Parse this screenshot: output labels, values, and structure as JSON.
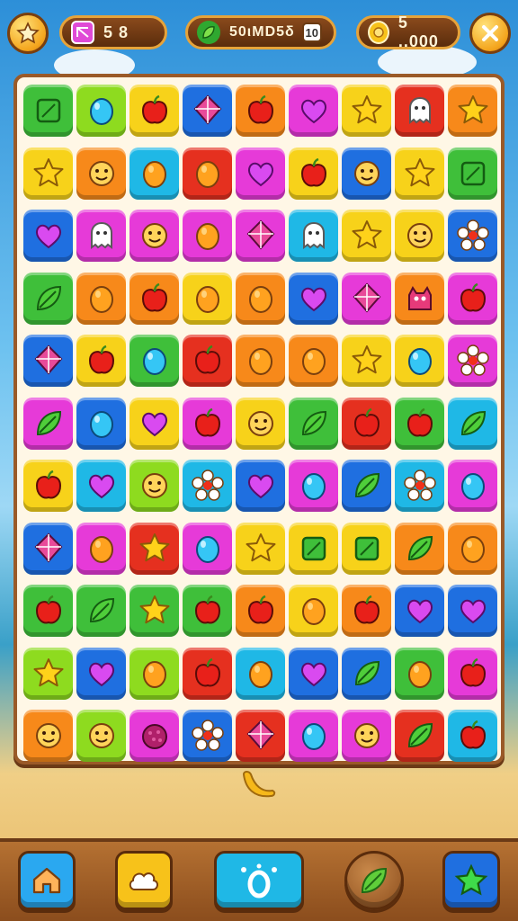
{
  "header": {
    "left_icon": "star-icon",
    "lives": {
      "icon": "ticket-icon",
      "value": "5 8"
    },
    "moves": {
      "icon": "leaf-icon",
      "value": "50ιMD5δ",
      "badge": "10"
    },
    "coins": {
      "icon": "coin-icon",
      "value": "5 ..000"
    },
    "close_icon": "close-icon"
  },
  "board": {
    "rows": [
      [
        [
          "green",
          "square"
        ],
        [
          "lime",
          "drop"
        ],
        [
          "yellow",
          "apple"
        ],
        [
          "blue",
          "kite"
        ],
        [
          "orange",
          "apple"
        ],
        [
          "magenta",
          "heart"
        ],
        [
          "yellow",
          "star"
        ],
        [
          "red",
          "ghost"
        ],
        [
          "orange",
          "star"
        ]
      ],
      [
        [
          "yellow",
          "star"
        ],
        [
          "orange",
          "face"
        ],
        [
          "cyan",
          "orange"
        ],
        [
          "red",
          "orange"
        ],
        [
          "magenta",
          "heart"
        ],
        [
          "yellow",
          "apple"
        ],
        [
          "blue",
          "face"
        ],
        [
          "yellow",
          "star"
        ],
        [
          "green",
          "square"
        ]
      ],
      [
        [
          "blue",
          "heart"
        ],
        [
          "magenta",
          "ghost"
        ],
        [
          "magenta",
          "face"
        ],
        [
          "magenta",
          "orange"
        ],
        [
          "magenta",
          "kite"
        ],
        [
          "cyan",
          "ghost"
        ],
        [
          "yellow",
          "star"
        ],
        [
          "yellow",
          "face"
        ],
        [
          "blue",
          "flower"
        ]
      ],
      [
        [
          "green",
          "leaf"
        ],
        [
          "orange",
          "orange"
        ],
        [
          "orange",
          "apple"
        ],
        [
          "yellow",
          "orange"
        ],
        [
          "orange",
          "orange"
        ],
        [
          "blue",
          "heart"
        ],
        [
          "magenta",
          "kite"
        ],
        [
          "orange",
          "monster"
        ],
        [
          "magenta",
          "apple"
        ]
      ],
      [
        [
          "blue",
          "kite"
        ],
        [
          "yellow",
          "apple"
        ],
        [
          "green",
          "drop"
        ],
        [
          "red",
          "apple"
        ],
        [
          "orange",
          "orange"
        ],
        [
          "orange",
          "orange"
        ],
        [
          "yellow",
          "star"
        ],
        [
          "yellow",
          "drop"
        ],
        [
          "magenta",
          "flower"
        ]
      ],
      [
        [
          "magenta",
          "leaf"
        ],
        [
          "blue",
          "drop"
        ],
        [
          "yellow",
          "heart"
        ],
        [
          "magenta",
          "apple"
        ],
        [
          "yellow",
          "face"
        ],
        [
          "green",
          "leaf"
        ],
        [
          "red",
          "apple"
        ],
        [
          "green",
          "apple"
        ],
        [
          "cyan",
          "leaf"
        ]
      ],
      [
        [
          "yellow",
          "apple"
        ],
        [
          "cyan",
          "heart"
        ],
        [
          "lime",
          "face"
        ],
        [
          "cyan",
          "flower"
        ],
        [
          "blue",
          "heart"
        ],
        [
          "magenta",
          "drop"
        ],
        [
          "blue",
          "leaf"
        ],
        [
          "cyan",
          "flower"
        ],
        [
          "magenta",
          "drop"
        ]
      ],
      [
        [
          "blue",
          "kite"
        ],
        [
          "magenta",
          "orange"
        ],
        [
          "red",
          "star"
        ],
        [
          "magenta",
          "drop"
        ],
        [
          "yellow",
          "star"
        ],
        [
          "yellow",
          "square"
        ],
        [
          "yellow",
          "square"
        ],
        [
          "orange",
          "leaf"
        ],
        [
          "orange",
          "orange"
        ]
      ],
      [
        [
          "green",
          "apple"
        ],
        [
          "green",
          "leaf"
        ],
        [
          "green",
          "star"
        ],
        [
          "green",
          "apple"
        ],
        [
          "orange",
          "apple"
        ],
        [
          "yellow",
          "orange"
        ],
        [
          "orange",
          "apple"
        ],
        [
          "blue",
          "heart"
        ],
        [
          "blue",
          "heart"
        ]
      ],
      [
        [
          "lime",
          "star"
        ],
        [
          "blue",
          "heart"
        ],
        [
          "lime",
          "orange"
        ],
        [
          "red",
          "apple"
        ],
        [
          "cyan",
          "orange"
        ],
        [
          "blue",
          "heart"
        ],
        [
          "blue",
          "leaf"
        ],
        [
          "green",
          "orange"
        ],
        [
          "magenta",
          "apple"
        ]
      ],
      [
        [
          "orange",
          "face"
        ],
        [
          "lime",
          "face"
        ],
        [
          "magenta",
          "berry"
        ],
        [
          "blue",
          "flower"
        ],
        [
          "red",
          "kite"
        ],
        [
          "magenta",
          "drop"
        ],
        [
          "magenta",
          "face"
        ],
        [
          "red",
          "leaf"
        ],
        [
          "cyan",
          "apple"
        ]
      ]
    ]
  },
  "floating_piece": "banana-icon",
  "footer": {
    "buttons": [
      {
        "name": "home-button",
        "icon": "house-icon"
      },
      {
        "name": "cloud-button",
        "icon": "cloud-icon"
      },
      {
        "name": "booster-button",
        "icon": "ring-icon"
      },
      {
        "name": "leaf-button",
        "icon": "leaf-icon"
      },
      {
        "name": "star-button",
        "icon": "star-icon"
      }
    ]
  },
  "colors": {
    "green": "#3fbf3a",
    "lime": "#8edb1f",
    "yellow": "#f7d21a",
    "blue": "#1f6fe0",
    "orange": "#f7891a",
    "magenta": "#e63ad8",
    "red": "#e5301f",
    "cyan": "#1fb8e6"
  }
}
